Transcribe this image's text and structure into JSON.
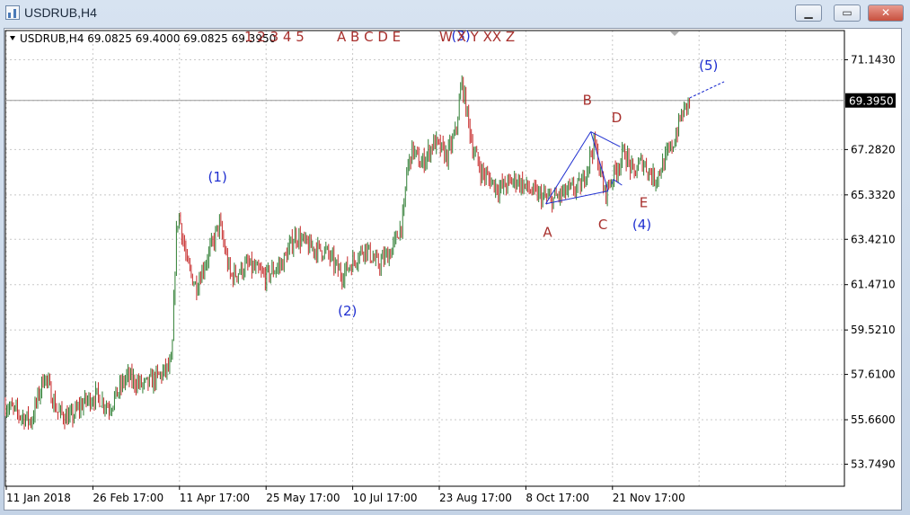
{
  "window": {
    "title": "USDRUB,H4"
  },
  "controls": {
    "minimize": "▁",
    "restore": "▭",
    "close": "✕"
  },
  "colors": {
    "up": "#2e7d32",
    "down": "#c62828",
    "wave_blue": "#1f2fd0",
    "wave_red": "#a8302d",
    "axis": "#000000",
    "grid": "#c8c8c8"
  },
  "header": {
    "symbol_line": "USDRUB,H4  69.0825 69.4000 69.0825 69.3950",
    "labels_a": "1 2 3 4 5",
    "labels_b": "A B C D E",
    "labels_c": "W X Y XX Z"
  },
  "price_tag": "69.3950",
  "chart_data": {
    "type": "candlestick",
    "symbol": "USDRUB",
    "timeframe": "H4",
    "ylim": [
      52.8,
      72.4
    ],
    "y_ticks": [
      "71.1430",
      "69.3950",
      "67.2820",
      "65.3320",
      "63.4210",
      "61.4710",
      "59.5210",
      "57.6100",
      "55.6600",
      "53.7490"
    ],
    "y_tick_values": [
      71.143,
      69.395,
      67.282,
      65.332,
      63.421,
      61.471,
      59.521,
      57.61,
      55.66,
      53.749
    ],
    "x_ticks": [
      "11 Jan 2018",
      "26 Feb 17:00",
      "11 Apr 17:00",
      "25 May 17:00",
      "10 Jul 17:00",
      "23 Aug 17:00",
      "8 Oct 17:00",
      "21 Nov 17:00"
    ],
    "x_tick_index": [
      0,
      1,
      2,
      3,
      4,
      5,
      6,
      7
    ],
    "x_max_index": 9.65,
    "last_close": 69.395,
    "close_path": [
      [
        0.0,
        56.3
      ],
      [
        0.15,
        55.9
      ],
      [
        0.3,
        55.6
      ],
      [
        0.45,
        57.6
      ],
      [
        0.6,
        56.0
      ],
      [
        0.75,
        55.7
      ],
      [
        0.9,
        56.4
      ],
      [
        1.05,
        56.7
      ],
      [
        1.2,
        56.2
      ],
      [
        1.4,
        57.5
      ],
      [
        1.6,
        57.1
      ],
      [
        1.8,
        57.6
      ],
      [
        1.92,
        58.0
      ],
      [
        1.97,
        63.4
      ],
      [
        2.0,
        64.6
      ],
      [
        2.1,
        62.3
      ],
      [
        2.2,
        61.4
      ],
      [
        2.4,
        63.3
      ],
      [
        2.47,
        64.1
      ],
      [
        2.6,
        61.8
      ],
      [
        2.8,
        62.3
      ],
      [
        3.0,
        61.8
      ],
      [
        3.2,
        62.4
      ],
      [
        3.35,
        63.6
      ],
      [
        3.5,
        63.1
      ],
      [
        3.7,
        62.9
      ],
      [
        3.88,
        61.9
      ],
      [
        4.0,
        62.4
      ],
      [
        4.15,
        63.1
      ],
      [
        4.3,
        62.3
      ],
      [
        4.45,
        62.9
      ],
      [
        4.5,
        63.3
      ],
      [
        4.6,
        64.4
      ],
      [
        4.63,
        66.3
      ],
      [
        4.7,
        67.3
      ],
      [
        4.8,
        66.6
      ],
      [
        4.95,
        67.6
      ],
      [
        5.1,
        67.0
      ],
      [
        5.2,
        68.0
      ],
      [
        5.27,
        70.2
      ],
      [
        5.4,
        67.3
      ],
      [
        5.5,
        66.3
      ],
      [
        5.7,
        65.6
      ],
      [
        5.9,
        66.0
      ],
      [
        6.1,
        65.4
      ],
      [
        6.3,
        65.1
      ],
      [
        6.5,
        65.5
      ],
      [
        6.65,
        65.7
      ],
      [
        6.8,
        67.6
      ],
      [
        6.92,
        65.4
      ],
      [
        7.0,
        66.0
      ],
      [
        7.15,
        67.2
      ],
      [
        7.25,
        66.2
      ],
      [
        7.35,
        66.8
      ],
      [
        7.5,
        66.0
      ],
      [
        7.6,
        66.7
      ],
      [
        7.72,
        67.6
      ],
      [
        7.8,
        68.7
      ],
      [
        7.9,
        69.4
      ]
    ],
    "wave_lines": [
      {
        "name": "A-B",
        "points": [
          [
            6.24,
            64.95
          ],
          [
            6.76,
            68.05
          ]
        ]
      },
      {
        "name": "B-C",
        "points": [
          [
            6.76,
            68.05
          ],
          [
            6.96,
            65.5
          ]
        ]
      },
      {
        "name": "A-C",
        "points": [
          [
            6.24,
            64.95
          ],
          [
            6.96,
            65.5
          ]
        ]
      },
      {
        "name": "B-D",
        "points": [
          [
            6.76,
            68.05
          ],
          [
            7.1,
            67.4
          ]
        ]
      },
      {
        "name": "C-E",
        "points": [
          [
            7.02,
            66.0
          ],
          [
            7.12,
            65.75
          ]
        ]
      },
      {
        "name": "E-projection",
        "points": [
          [
            7.02,
            66.0
          ],
          [
            7.0,
            65.8
          ]
        ]
      }
    ],
    "projection": [
      [
        7.9,
        69.5
      ],
      [
        8.3,
        70.2
      ]
    ],
    "annotations": [
      {
        "text": "(1)",
        "x": 2.45,
        "y": 65.9,
        "color": "blue"
      },
      {
        "text": "(2)",
        "x": 3.95,
        "y": 60.15,
        "color": "blue"
      },
      {
        "text": "(3)",
        "x": 5.26,
        "y": 71.98,
        "color": "blue"
      },
      {
        "text": "(4)",
        "x": 7.35,
        "y": 63.85,
        "color": "blue"
      },
      {
        "text": "(5)",
        "x": 8.12,
        "y": 70.7,
        "color": "blue"
      },
      {
        "text": "A",
        "x": 6.26,
        "y": 63.52,
        "color": "red"
      },
      {
        "text": "B",
        "x": 6.72,
        "y": 69.22,
        "color": "red"
      },
      {
        "text": "C",
        "x": 6.9,
        "y": 63.85,
        "color": "red"
      },
      {
        "text": "D",
        "x": 7.06,
        "y": 68.45,
        "color": "red"
      },
      {
        "text": "E",
        "x": 7.37,
        "y": 64.8,
        "color": "red"
      }
    ]
  }
}
